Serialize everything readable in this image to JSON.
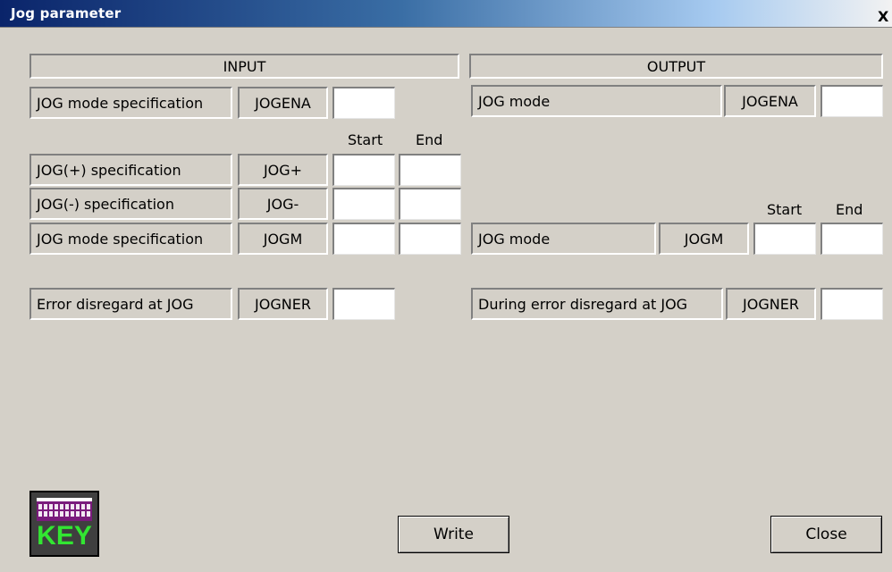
{
  "window": {
    "title": "Jog parameter",
    "close_glyph": "X"
  },
  "input": {
    "header": "INPUT",
    "mode_spec": {
      "label": "JOG mode specification",
      "code": "JOGENA",
      "value": ""
    },
    "start_label": "Start",
    "end_label": "End",
    "rows": [
      {
        "label": "JOG(+) specification",
        "code": "JOG+",
        "start": "",
        "end": ""
      },
      {
        "label": "JOG(-) specification",
        "code": "JOG-",
        "start": "",
        "end": ""
      },
      {
        "label": "JOG mode specification",
        "code": "JOGM",
        "start": "",
        "end": ""
      }
    ],
    "error": {
      "label": "Error disregard at JOG",
      "code": "JOGNER",
      "value": ""
    }
  },
  "output": {
    "header": "OUTPUT",
    "mode": {
      "label": "JOG mode",
      "code": "JOGENA",
      "value": ""
    },
    "start_label": "Start",
    "end_label": "End",
    "jogm": {
      "label": "JOG mode",
      "code": "JOGM",
      "start": "",
      "end": ""
    },
    "error": {
      "label": "During error disregard at JOG",
      "code": "JOGNER",
      "value": ""
    }
  },
  "footer": {
    "key_icon": {
      "icon": "keyboard-icon",
      "text": "KEY"
    },
    "write_label": "Write",
    "close_label": "Close"
  },
  "colors": {
    "dialog_bg": "#d4d0c8",
    "title_start": "#0a246a",
    "title_end": "#a6caf0",
    "key_text": "#32e632",
    "key_bar": "#7a1b7c"
  }
}
